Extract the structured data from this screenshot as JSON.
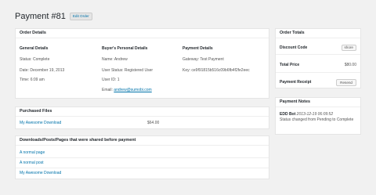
{
  "header": {
    "title": "Payment #81",
    "edit_label": "Edit Order"
  },
  "order_details": {
    "title": "Order Details",
    "general": {
      "heading": "General Details",
      "status": "Status: Complete",
      "date": "Date: December 19, 2013",
      "time": "Time: 6:09 am"
    },
    "buyer": {
      "heading": "Buyer's Personal Details",
      "name": "Name: Andrew",
      "user_status": "User Status: Registered User",
      "user_id": "User ID: 1",
      "email_label": "Email:",
      "email": "andrew@sumobi.com"
    },
    "payment": {
      "heading": "Payment Details",
      "gateway": "Gateway: Test Payment",
      "key": "Key: ce9f91815b516c09b6fb4f2fe2eec"
    }
  },
  "purchased_files": {
    "title": "Purchased Files",
    "items": [
      {
        "name": "My Awesome Download",
        "price": "$64.00"
      }
    ]
  },
  "shared": {
    "title": "Downloads/Posts/Pages that were shared before payment",
    "items": [
      "A normal page",
      "A normal post",
      "My Awesome Download"
    ]
  },
  "order_totals": {
    "title": "Order Totals",
    "discount_label": "Discount Code",
    "discount_value": "shore",
    "total_label": "Total Price",
    "total_value": "$80.00",
    "receipt_label": "Payment Receipt",
    "resend_label": "Resend"
  },
  "payment_notes": {
    "title": "Payment Notes",
    "author": "EDD Bot",
    "timestamp": "2013-12-19 06:09:52",
    "message": "Status changed from Pending to Complete"
  }
}
